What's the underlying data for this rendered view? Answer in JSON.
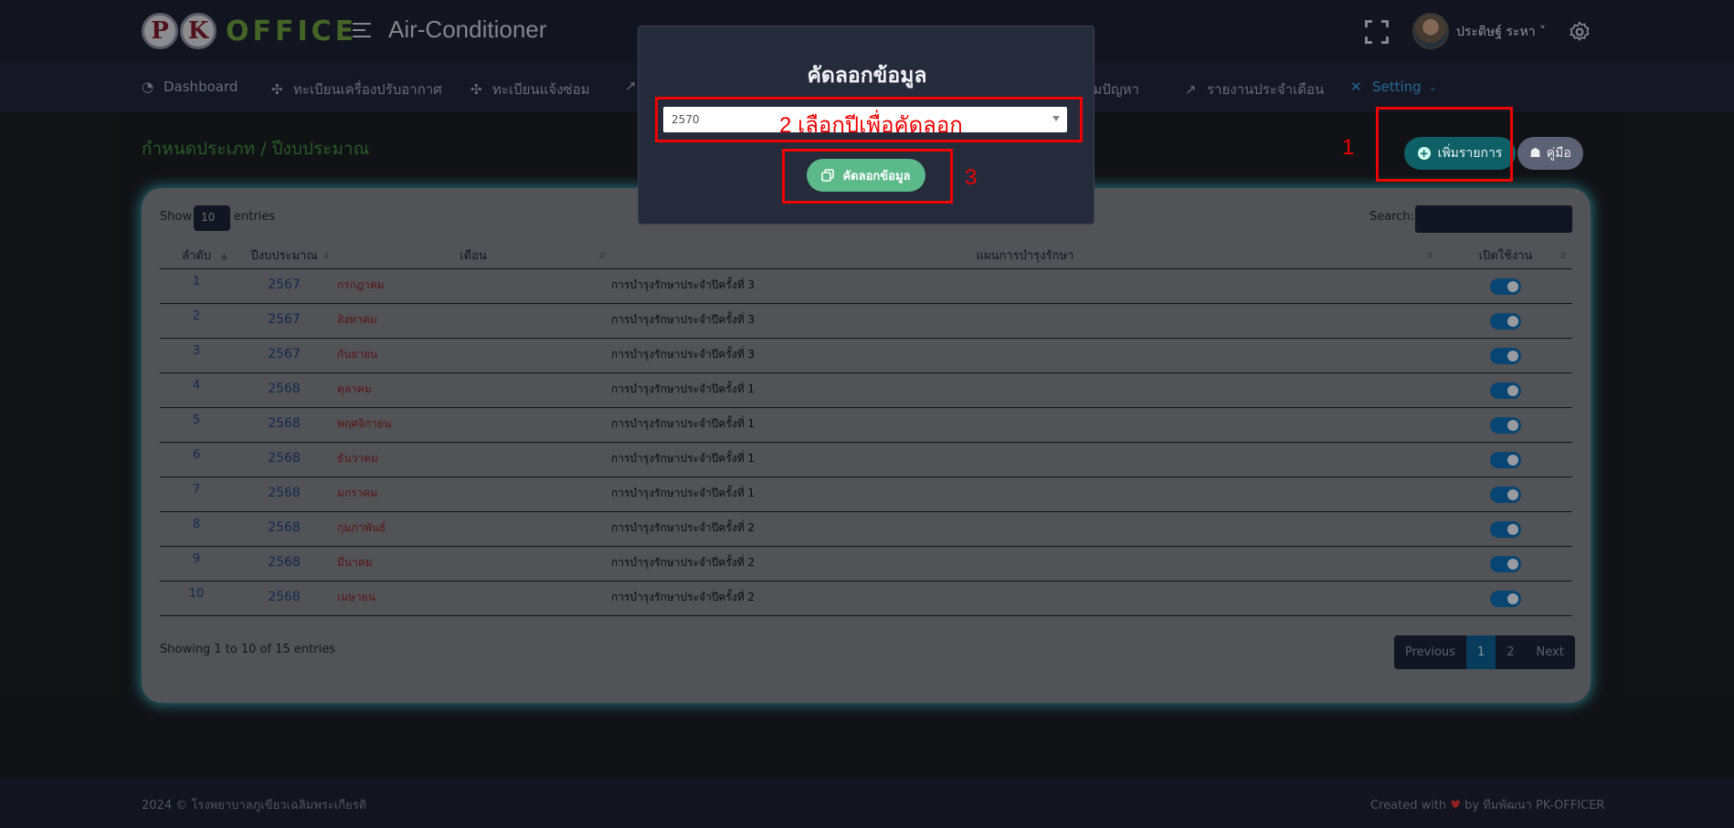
{
  "header": {
    "logo_p": "P",
    "logo_k": "K",
    "logo_word": "OFFICE",
    "app_title": "Air-Conditioner",
    "username": "ประดิษฐ์ ระหา ˅"
  },
  "nav": {
    "items": [
      {
        "label": "Dashboard",
        "icon": "pie-chart-icon"
      },
      {
        "label": "ทะเบียนเครื่องปรับอากาศ",
        "icon": "fan-icon"
      },
      {
        "label": "ทะเบียนแจ้งซ่อม",
        "icon": "fan-icon"
      },
      {
        "label": "ามปัญหา",
        "icon": ""
      },
      {
        "label": "รายงานประจำเดือน",
        "icon": "line-chart-icon"
      },
      {
        "label": "Setting",
        "icon": "tools-icon"
      }
    ]
  },
  "page": {
    "title": "กำหนดประเภท / ปีงบประมาณ",
    "add_button": "เพิ่มรายการ",
    "guide_button": "คู่มือ",
    "step1": "1"
  },
  "table": {
    "show_label": "Show",
    "show_value": "10",
    "entries_label": "entries",
    "search_label": "Search:",
    "columns": [
      "ลำดับ",
      "ปีงบประมาณ",
      "เดือน",
      "แผนการบำรุงรักษา",
      "เปิดใช้งาน"
    ],
    "rows": [
      {
        "no": "1",
        "year": "2567",
        "month": "กรกฎาคม",
        "plan": "การบำรุงรักษาประจำปีครั้งที่ 3",
        "enabled": true
      },
      {
        "no": "2",
        "year": "2567",
        "month": "สิงหาคม",
        "plan": "การบำรุงรักษาประจำปีครั้งที่ 3",
        "enabled": true
      },
      {
        "no": "3",
        "year": "2567",
        "month": "กันยายน",
        "plan": "การบำรุงรักษาประจำปีครั้งที่ 3",
        "enabled": true
      },
      {
        "no": "4",
        "year": "2568",
        "month": "ตุลาคม",
        "plan": "การบำรุงรักษาประจำปีครั้งที่ 1",
        "enabled": true
      },
      {
        "no": "5",
        "year": "2568",
        "month": "พฤศจิกายน",
        "plan": "การบำรุงรักษาประจำปีครั้งที่ 1",
        "enabled": true
      },
      {
        "no": "6",
        "year": "2568",
        "month": "ธันวาคม",
        "plan": "การบำรุงรักษาประจำปีครั้งที่ 1",
        "enabled": true
      },
      {
        "no": "7",
        "year": "2568",
        "month": "มกราคม",
        "plan": "การบำรุงรักษาประจำปีครั้งที่ 1",
        "enabled": true
      },
      {
        "no": "8",
        "year": "2568",
        "month": "กุมภาพันธ์",
        "plan": "การบำรุงรักษาประจำปีครั้งที่ 2",
        "enabled": true
      },
      {
        "no": "9",
        "year": "2568",
        "month": "มีนาคม",
        "plan": "การบำรุงรักษาประจำปีครั้งที่ 2",
        "enabled": true
      },
      {
        "no": "10",
        "year": "2568",
        "month": "เมษายน",
        "plan": "การบำรุงรักษาประจำปีครั้งที่ 2",
        "enabled": true
      }
    ],
    "showing": "Showing 1 to 10 of 15 entries",
    "pager": {
      "prev": "Previous",
      "p1": "1",
      "p2": "2",
      "next": "Next"
    }
  },
  "footer": {
    "left": "2024 © โรงพยาบาลภูเขียวเฉลิมพระเกียรติ",
    "right_prefix": "Created with",
    "heart": "♥",
    "right_suffix": "by ทีมพัฒนา PK-OFFICER"
  },
  "modal": {
    "title": "คัดลอกข้อมูล",
    "year_value": "2570",
    "step2": "2 เลือกปีเพื่อคัดลอก",
    "copy_button": "คัดลอกข้อมูล",
    "step3": "3"
  },
  "colors": {
    "accent": "#3aa0e8",
    "annotation_red": "#ee0000",
    "title_green": "#3e8d3f",
    "toggle_on": "#0d6ab0"
  }
}
